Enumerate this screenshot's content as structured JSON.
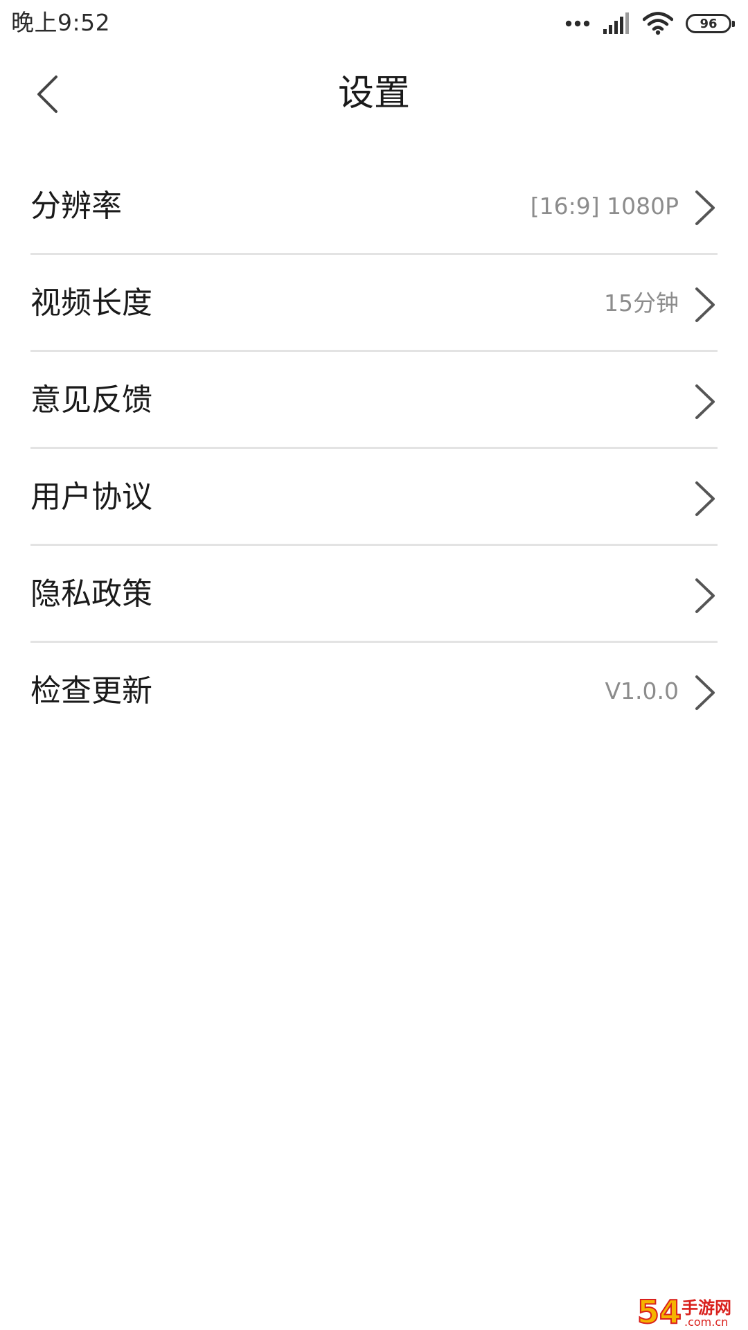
{
  "status_bar": {
    "time": "晚上9:52",
    "battery": "96",
    "icons": [
      "more-dots-icon",
      "signal-icon",
      "wifi-icon",
      "battery-icon"
    ]
  },
  "header": {
    "title": "设置",
    "back_icon": "chevron-left-icon"
  },
  "settings": [
    {
      "label": "分辨率",
      "value": "[16:9] 1080P"
    },
    {
      "label": "视频长度",
      "value": "15分钟"
    },
    {
      "label": "意见反馈",
      "value": ""
    },
    {
      "label": "用户协议",
      "value": ""
    },
    {
      "label": "隐私政策",
      "value": ""
    },
    {
      "label": "检查更新",
      "value": "V1.0.0"
    }
  ],
  "watermark": {
    "text": "54手游网",
    "domain": ".com.cn"
  },
  "colors": {
    "text_primary": "#1a1a1a",
    "text_secondary": "#8c8c8c",
    "divider": "#e3e3e3",
    "chevron": "#555555",
    "watermark_yellow": "#f5b400",
    "watermark_red": "#d9201c"
  }
}
